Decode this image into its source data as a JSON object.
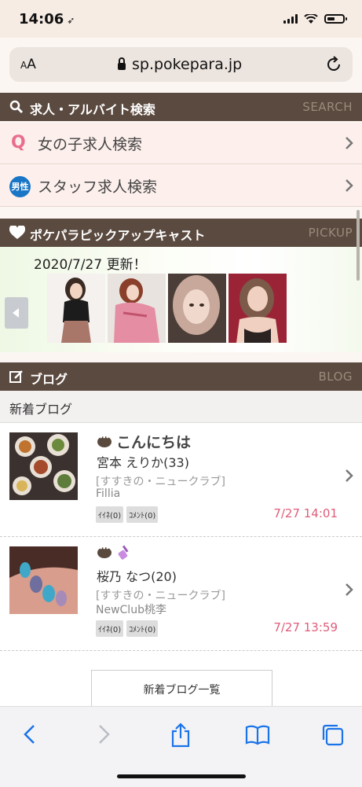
{
  "status_bar": {
    "time": "14:06"
  },
  "browser": {
    "text_size_label": "AA",
    "url": "sp.pokepara.jp"
  },
  "search_section": {
    "title": "求人・アルバイト検索",
    "en": "SEARCH",
    "items": [
      {
        "icon": "female-q-icon",
        "label": "女の子求人検索"
      },
      {
        "icon": "male-badge-icon",
        "badge": "男性",
        "label": "スタッフ求人検索"
      }
    ]
  },
  "pickup_section": {
    "title": "ポケパラピックアップキャスト",
    "en": "PICKUP",
    "updated": "2020/7/27 更新！",
    "casts": 4
  },
  "blog_section": {
    "title": "ブログ",
    "en": "BLOG",
    "subheading": "新着ブログ",
    "posts": [
      {
        "title": "こんにちは",
        "name": "宮本 えりか(33)",
        "area": "[すすきの・ニュークラブ]",
        "club": "Fillia",
        "likes": "ｲｲﾈ(0)",
        "comments": "ｺﾒﾝﾄ(0)",
        "time": "7/27 14:01"
      },
      {
        "title": "",
        "name": "桜乃 なつ(20)",
        "area": "[すすきの・ニュークラブ]",
        "club": "NewClub桃李",
        "likes": "ｲｲﾈ(0)",
        "comments": "ｺﾒﾝﾄ(0)",
        "time": "7/27 13:59"
      }
    ],
    "list_button": "新着ブログ一覧"
  },
  "colors": {
    "header_bg": "#5b4a3f",
    "accent_pink": "#e05c79",
    "toolbar_blue": "#1a73e8"
  }
}
